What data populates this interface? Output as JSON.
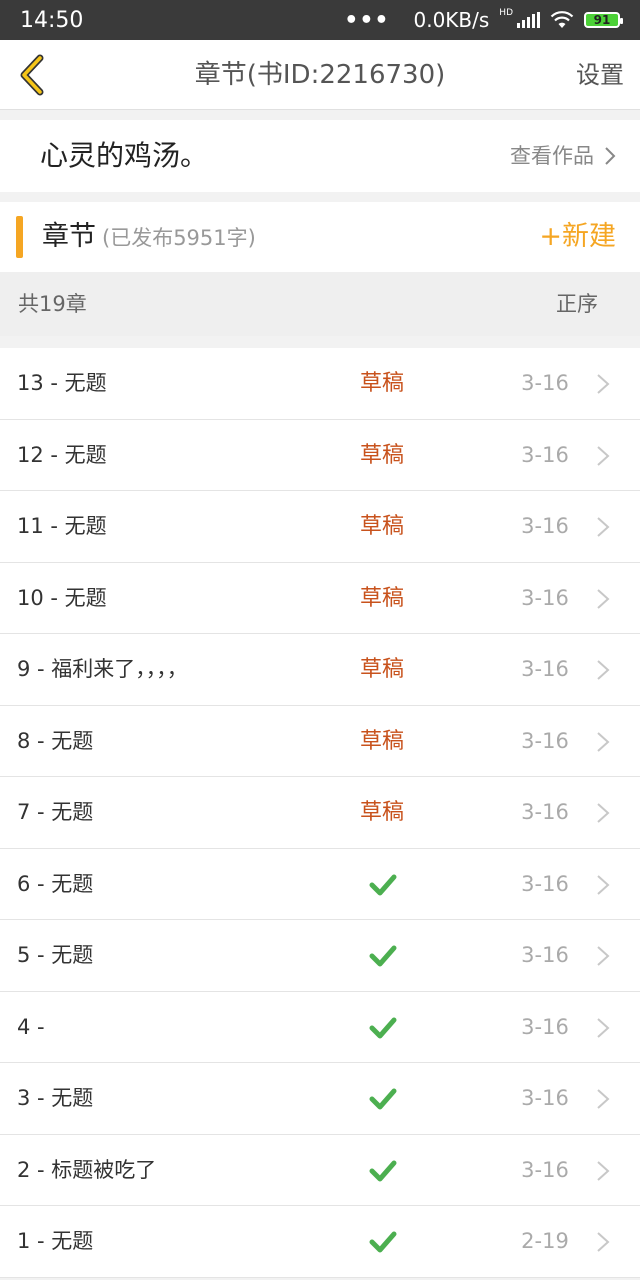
{
  "status_bar": {
    "time": "14:50",
    "dots": "•••",
    "network_speed": "0.0KB/s",
    "hd_label": "HD",
    "battery": "91"
  },
  "header": {
    "title": "章节(书ID:2216730)",
    "settings_label": "设置",
    "back_icon": "chevron-left-icon",
    "accent_color": "#f5a623"
  },
  "book": {
    "title": "心灵的鸡汤。",
    "view_works_label": "查看作品"
  },
  "chapters_section": {
    "title": "章节",
    "subtitle": "(已发布5951字)",
    "new_label": "+新建",
    "count_label": "共19章",
    "sort_label": "正序"
  },
  "chapters": [
    {
      "title": "13 - 无题",
      "status": "草稿",
      "published": false,
      "date": "3-16"
    },
    {
      "title": "12 - 无题",
      "status": "草稿",
      "published": false,
      "date": "3-16"
    },
    {
      "title": "11 - 无题",
      "status": "草稿",
      "published": false,
      "date": "3-16"
    },
    {
      "title": "10 - 无题",
      "status": "草稿",
      "published": false,
      "date": "3-16"
    },
    {
      "title": "9 - 福利来了，，，，",
      "status": "草稿",
      "published": false,
      "date": "3-16"
    },
    {
      "title": "8 - 无题",
      "status": "草稿",
      "published": false,
      "date": "3-16"
    },
    {
      "title": "7 - 无题",
      "status": "草稿",
      "published": false,
      "date": "3-16"
    },
    {
      "title": "6 - 无题",
      "status": "",
      "published": true,
      "date": "3-16"
    },
    {
      "title": "5 - 无题",
      "status": "",
      "published": true,
      "date": "3-16"
    },
    {
      "title": "4 - ",
      "status": "",
      "published": true,
      "date": "3-16"
    },
    {
      "title": "3 - 无题",
      "status": "",
      "published": true,
      "date": "3-16"
    },
    {
      "title": "2 - 标题被吃了",
      "status": "",
      "published": true,
      "date": "3-16"
    },
    {
      "title": "1 - 无题",
      "status": "",
      "published": true,
      "date": "2-19"
    }
  ],
  "colors": {
    "draft": "#c8521c",
    "published_check": "#4caf50",
    "accent": "#f5a623"
  }
}
